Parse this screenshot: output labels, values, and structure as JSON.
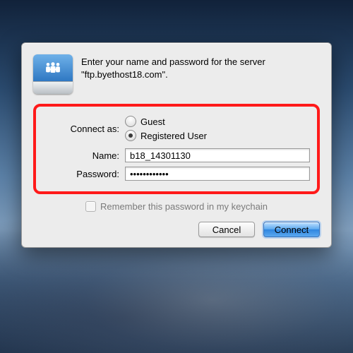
{
  "prompt": "Enter your name and password for the server \"ftp.byethost18.com\".",
  "connect_as_label": "Connect as:",
  "options": {
    "guest": {
      "label": "Guest",
      "selected": false
    },
    "registered": {
      "label": "Registered User",
      "selected": true
    }
  },
  "name": {
    "label": "Name:",
    "value": "b18_14301130"
  },
  "password": {
    "label": "Password:",
    "value": "••••••••••••"
  },
  "remember": {
    "label": "Remember this password in my keychain",
    "checked": false
  },
  "buttons": {
    "cancel": "Cancel",
    "connect": "Connect"
  },
  "icon": "file-sharing-people-icon"
}
